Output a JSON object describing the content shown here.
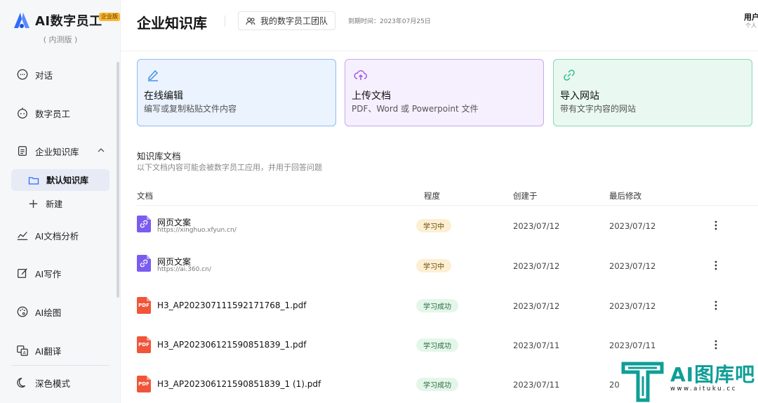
{
  "brand": {
    "name": "AI数字员工",
    "badge": "企业版",
    "subtitle": "( 内测版 )"
  },
  "sidebar": {
    "items": [
      {
        "label": "对话",
        "icon": "chat-icon"
      },
      {
        "label": "数字员工",
        "icon": "robot-icon"
      },
      {
        "label": "企业知识库",
        "icon": "document-icon"
      },
      {
        "label": "AI文档分析",
        "icon": "chart-icon"
      },
      {
        "label": "AI写作",
        "icon": "edit-icon"
      },
      {
        "label": "AI绘图",
        "icon": "palette-icon"
      },
      {
        "label": "AI翻译",
        "icon": "translate-icon"
      },
      {
        "label": "深色模式",
        "icon": "moon-icon"
      }
    ],
    "sub_items": [
      {
        "label": "默认知识库",
        "icon": "folder-icon",
        "active": true
      },
      {
        "label": "新建",
        "icon": "plus-icon"
      }
    ]
  },
  "header": {
    "title": "企业知识库",
    "team_button": "我的数字员工团队",
    "expiry": "到期时间：2023年07月25日",
    "user_name": "用户",
    "user_sub": "个人"
  },
  "cards": [
    {
      "title": "在线编辑",
      "desc": "编写或复制粘贴文件内容",
      "icon": "pen-icon",
      "color": "#4a8fe7"
    },
    {
      "title": "上传文档",
      "desc": "PDF、Word 或 Powerpoint 文件",
      "icon": "cloud-upload-icon",
      "color": "#9b59e6"
    },
    {
      "title": "导入网站",
      "desc": "带有文字内容的网站",
      "icon": "link-icon",
      "color": "#2cbf83"
    }
  ],
  "section": {
    "title": "知识库文档",
    "desc": "以下文档内容可能会被数字员工应用，并用于回答问题"
  },
  "table": {
    "headers": {
      "doc": "文档",
      "level": "程度",
      "created": "创建于",
      "modified": "最后修改"
    },
    "rows": [
      {
        "type": "link",
        "name": "网页文案",
        "url": "https://xinghuo.xfyun.cn/",
        "status": "学习中",
        "status_kind": "learning",
        "created": "2023/07/12",
        "modified": "2023/07/12"
      },
      {
        "type": "link",
        "name": "网页文案",
        "url": "https://ai.360.cn/",
        "status": "学习中",
        "status_kind": "learning",
        "created": "2023/07/12",
        "modified": "2023/07/12"
      },
      {
        "type": "pdf",
        "name": "H3_AP202307111592171768_1.pdf",
        "url": "",
        "status": "学习成功",
        "status_kind": "success",
        "created": "2023/07/12",
        "modified": "2023/07/12"
      },
      {
        "type": "pdf",
        "name": "H3_AP202306121590851839_1.pdf",
        "url": "",
        "status": "学习成功",
        "status_kind": "success",
        "created": "2023/07/11",
        "modified": "2023/07/11"
      },
      {
        "type": "pdf",
        "name": "H3_AP202306121590851839_1 (1).pdf",
        "url": "",
        "status": "学习成功",
        "status_kind": "success",
        "created": "2023/07/11",
        "modified": "20"
      }
    ],
    "pdf_label": "PDF"
  },
  "watermark": {
    "text": "AI图库吧",
    "url": "www.aituku.cc"
  }
}
